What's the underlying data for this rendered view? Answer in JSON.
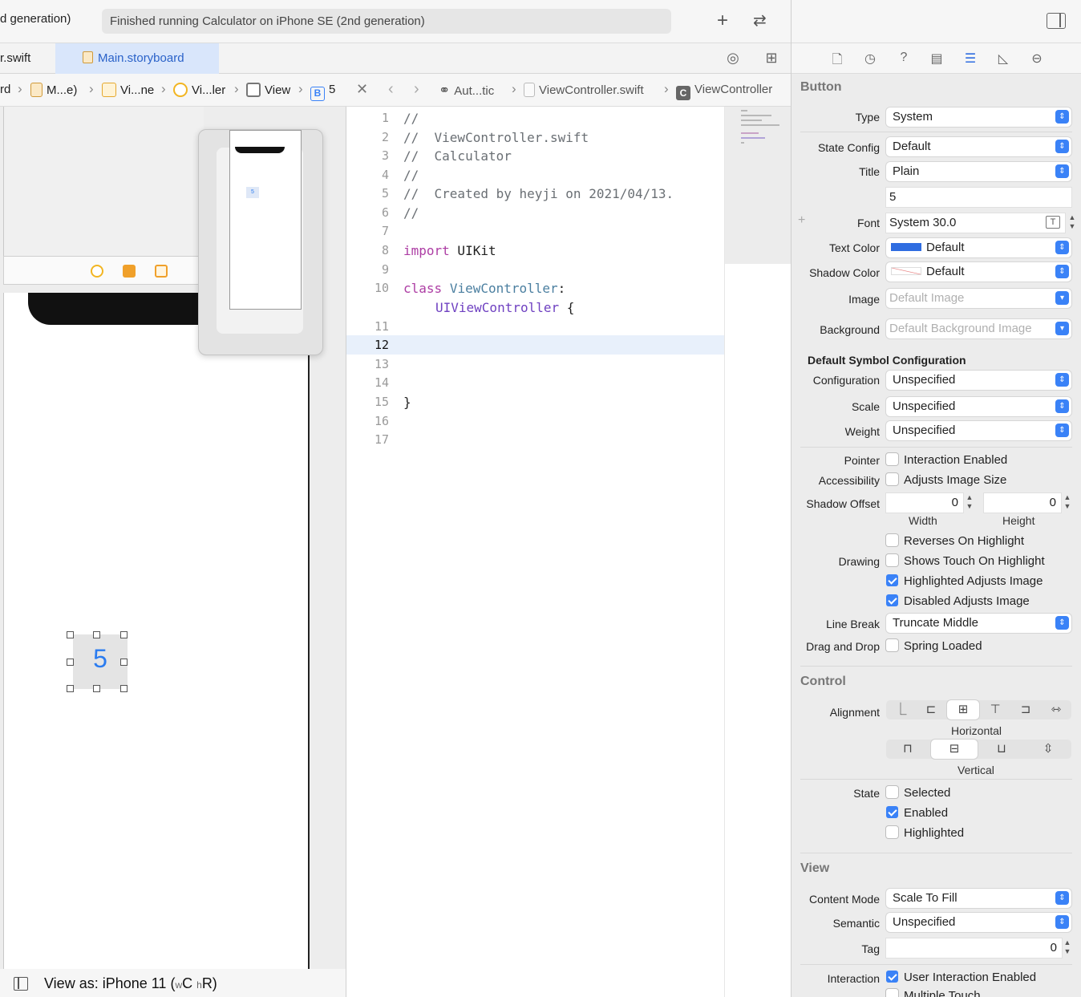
{
  "toolbar": {
    "scheme_text": "d generation)",
    "status": "Finished running Calculator on iPhone SE (2nd generation)",
    "add_icon": "plus-icon",
    "swap_icon": "arrows-icon"
  },
  "tabs": [
    {
      "label": "r.swift"
    },
    {
      "label": "Main.storyboard"
    }
  ],
  "left_crumbs": [
    "rd",
    "M...e)",
    "Vi...ne",
    "Vi...ler",
    "View",
    "5"
  ],
  "right_crumbs": [
    "Aut...tic",
    "ViewController.swift",
    "ViewController"
  ],
  "canvas": {
    "button_title": "5",
    "footer_label": "View as: iPhone 11 (",
    "footer_w": "w",
    "footer_c": "C",
    "footer_h": "h",
    "footer_r": "R)"
  },
  "code": {
    "lines": [
      {
        "n": "1",
        "text": "//"
      },
      {
        "n": "2",
        "text": "//  ViewController.swift"
      },
      {
        "n": "3",
        "text": "//  Calculator"
      },
      {
        "n": "4",
        "text": "//"
      },
      {
        "n": "5",
        "text": "//  Created by heyji on 2021/04/13."
      },
      {
        "n": "6",
        "text": "//"
      },
      {
        "n": "7",
        "text": ""
      },
      {
        "n": "8",
        "kw": "import",
        "rest": " UIKit"
      },
      {
        "n": "9",
        "text": ""
      },
      {
        "n": "10",
        "kw": "class",
        "name": "ViewController",
        "colon": ":"
      },
      {
        "n": "",
        "super": "UIViewController",
        "brace": " {"
      },
      {
        "n": "11",
        "text": ""
      },
      {
        "n": "12",
        "text": ""
      },
      {
        "n": "13",
        "text": ""
      },
      {
        "n": "14",
        "text": ""
      },
      {
        "n": "15",
        "text": "}"
      },
      {
        "n": "16",
        "text": ""
      },
      {
        "n": "17",
        "text": ""
      }
    ]
  },
  "inspector": {
    "section_button": "Button",
    "type_label": "Type",
    "type_value": "System",
    "state_config_label": "State Config",
    "state_config_value": "Default",
    "title_label": "Title",
    "title_value": "Plain",
    "title_text": "5",
    "font_label": "Font",
    "font_value": "System 30.0",
    "text_color_label": "Text Color",
    "text_color_value": "Default",
    "text_color_hex": "#2f6de1",
    "shadow_color_label": "Shadow Color",
    "shadow_color_value": "Default",
    "image_label": "Image",
    "image_placeholder": "Default Image",
    "background_label": "Background",
    "background_placeholder": "Default Background Image",
    "symbol_config_title": "Default Symbol Configuration",
    "configuration_label": "Configuration",
    "configuration_value": "Unspecified",
    "scale_label": "Scale",
    "scale_value": "Unspecified",
    "weight_label": "Weight",
    "weight_value": "Unspecified",
    "pointer_label": "Pointer",
    "pointer_option": "Interaction Enabled",
    "accessibility_label": "Accessibility",
    "accessibility_option": "Adjusts Image Size",
    "shadow_offset_label": "Shadow Offset",
    "shadow_width": "0",
    "shadow_height": "0",
    "width_caption": "Width",
    "height_caption": "Height",
    "drawing_label": "Drawing",
    "drawing_options": [
      "Reverses On Highlight",
      "Shows Touch On Highlight",
      "Highlighted Adjusts Image",
      "Disabled Adjusts Image"
    ],
    "line_break_label": "Line Break",
    "line_break_value": "Truncate Middle",
    "drag_drop_label": "Drag and Drop",
    "drag_drop_option": "Spring Loaded",
    "section_control": "Control",
    "alignment_label": "Alignment",
    "horizontal_caption": "Horizontal",
    "vertical_caption": "Vertical",
    "state_label": "State",
    "state_options": [
      "Selected",
      "Enabled",
      "Highlighted"
    ],
    "section_view": "View",
    "content_mode_label": "Content Mode",
    "content_mode_value": "Scale To Fill",
    "semantic_label": "Semantic",
    "semantic_value": "Unspecified",
    "tag_label": "Tag",
    "tag_value": "0",
    "interaction_label": "Interaction",
    "interaction_option": "User Interaction Enabled",
    "multiple_touch_option": "Multiple Touch"
  }
}
